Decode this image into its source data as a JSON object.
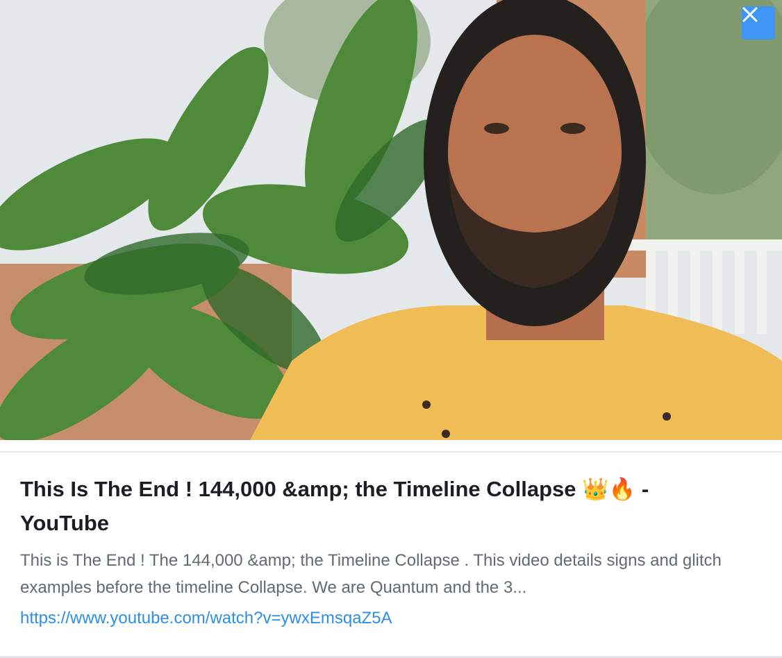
{
  "preview": {
    "title": "This Is The End ! 144,000 &amp; the Timeline Collapse 👑🔥 - YouTube",
    "description": "This is The End ! The 144,000 &amp; the Timeline Collapse . This video details signs and glitch examples before the timeline Collapse. We are Quantum and the 3...",
    "url": "https://www.youtube.com/watch?v=ywxEmsqaZ5A",
    "close_icon": "close-icon",
    "colors": {
      "close_button": "#3f96f5",
      "link": "#2b8ee8",
      "title": "#1b1f23",
      "description": "#5f6a74"
    }
  }
}
